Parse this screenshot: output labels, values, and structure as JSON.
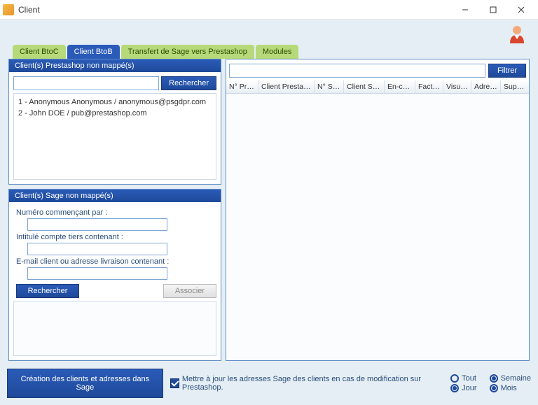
{
  "window": {
    "title": "Client"
  },
  "tabs": [
    "Client BtoC",
    "Client BtoB",
    "Transfert de Sage vers Prestashop",
    "Modules"
  ],
  "activeTab": 1,
  "leftTop": {
    "header": "Client(s) Prestashop non mappé(s)",
    "searchBtn": "Rechercher",
    "items": [
      "1 - Anonymous Anonymous / anonymous@psgdpr.com",
      "2 - John DOE / pub@prestashop.com"
    ]
  },
  "leftBottom": {
    "header": "Client(s) Sage non mappé(s)",
    "label1": "Numéro commençant par :",
    "label2": "Intitulé compte tiers contenant :",
    "label3": "E-mail client ou adresse livraison contenant :",
    "searchBtn": "Rechercher",
    "assocBtn": "Associer"
  },
  "right": {
    "filterBtn": "Filtrer",
    "columns": [
      "N° Presta",
      "Client Prestashop",
      "N° Sage",
      "Client Sage",
      "En-cour",
      "Facture",
      "Visualis",
      "Adresse",
      "Supprin"
    ]
  },
  "footer": {
    "createBtn": "Création des clients et adresses dans Sage",
    "checkboxLabel": "Mettre à jour les adresses Sage des clients en cas de modification sur Prestashop.",
    "radios": [
      "Tout",
      "Semaine",
      "Jour",
      "Mois"
    ]
  }
}
